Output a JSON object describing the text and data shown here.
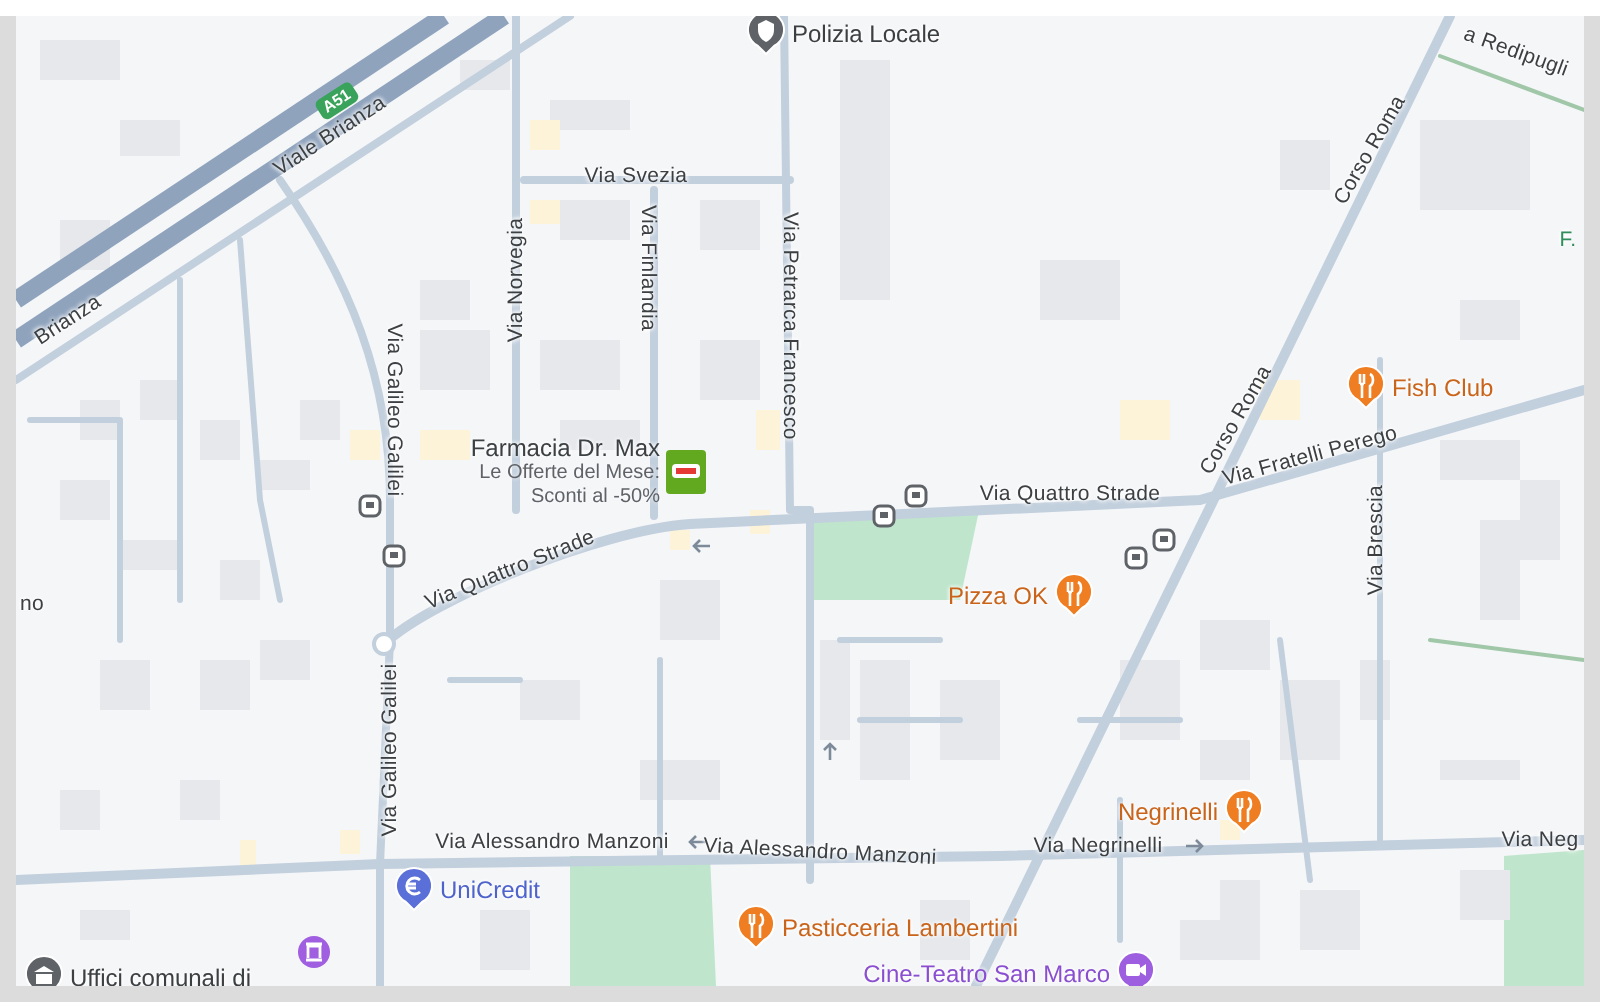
{
  "map": {
    "shield": "A51",
    "street_labels": [
      "Viale Brianza",
      "Brianza",
      "Via Svezia",
      "Via Norvegia",
      "Via Finlandia",
      "Via Petrarca Francesco",
      "Via Galileo Galilei",
      "Via Quattro Strade",
      "Via Quattro Strade",
      "Via Fratelli Perego",
      "Corso Roma",
      "Corso Roma",
      "Via Brescia",
      "a Redipugli",
      "Via Galileo Galilei",
      "Via Alessandro Manzoni",
      "Via Alessandro Manzoni",
      "Via Negrinelli",
      "Via Neg",
      "no",
      "F."
    ],
    "places": [
      {
        "name": "Polizia Locale",
        "kind": "police"
      },
      {
        "name": "Farmacia Dr. Max",
        "subtitle": "Le Offerte del Mese: Sconti al -50%",
        "kind": "pharmacy"
      },
      {
        "name": "Fish Club",
        "kind": "restaurant"
      },
      {
        "name": "Pizza OK",
        "kind": "restaurant"
      },
      {
        "name": "Negrinelli",
        "kind": "restaurant"
      },
      {
        "name": "Pasticceria Lambertini",
        "kind": "restaurant"
      },
      {
        "name": "UniCredit",
        "kind": "bank"
      },
      {
        "name": "Uffici comunali di",
        "kind": "government"
      },
      {
        "name": "Cine-Teatro San Marco",
        "kind": "cinema"
      }
    ]
  }
}
